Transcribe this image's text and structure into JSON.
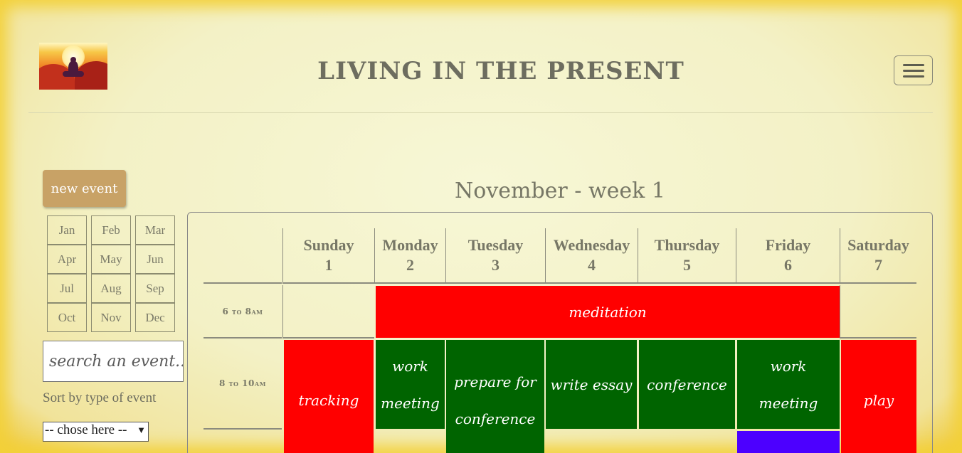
{
  "header": {
    "title": "LIVING IN THE PRESENT",
    "logo_icon": "meditation-logo",
    "menu_icon": "hamburger-icon"
  },
  "sidebar": {
    "new_event_label": "new event",
    "months": [
      "Jan",
      "Feb",
      "Mar",
      "Apr",
      "May",
      "Jun",
      "Jul",
      "Aug",
      "Sep",
      "Oct",
      "Nov",
      "Dec"
    ],
    "search_placeholder": "search an event...",
    "sort_label": "Sort by type of event",
    "select_value": "-- chose here --"
  },
  "calendar": {
    "week_title": "November - week 1",
    "days": [
      {
        "name": "Sunday",
        "date": "1"
      },
      {
        "name": "Monday",
        "date": "2"
      },
      {
        "name": "Tuesday",
        "date": "3"
      },
      {
        "name": "Wednesday",
        "date": "4"
      },
      {
        "name": "Thursday",
        "date": "5"
      },
      {
        "name": "Friday",
        "date": "6"
      },
      {
        "name": "Saturday",
        "date": "7"
      }
    ],
    "time_slots": [
      "6 to 8am",
      "8 to 10am"
    ],
    "events": {
      "meditation": "meditation",
      "tracking": "tracking",
      "work_meeting_mon": "work meeting",
      "prepare": "prepare for conference",
      "write_essay": "write essay",
      "conference": "conference",
      "work_meeting_fri": "work meeting",
      "play": "play"
    },
    "colors": {
      "red": "#ff0000",
      "green": "#006400",
      "blue": "#4c00ff",
      "button": "#c8a266"
    }
  }
}
